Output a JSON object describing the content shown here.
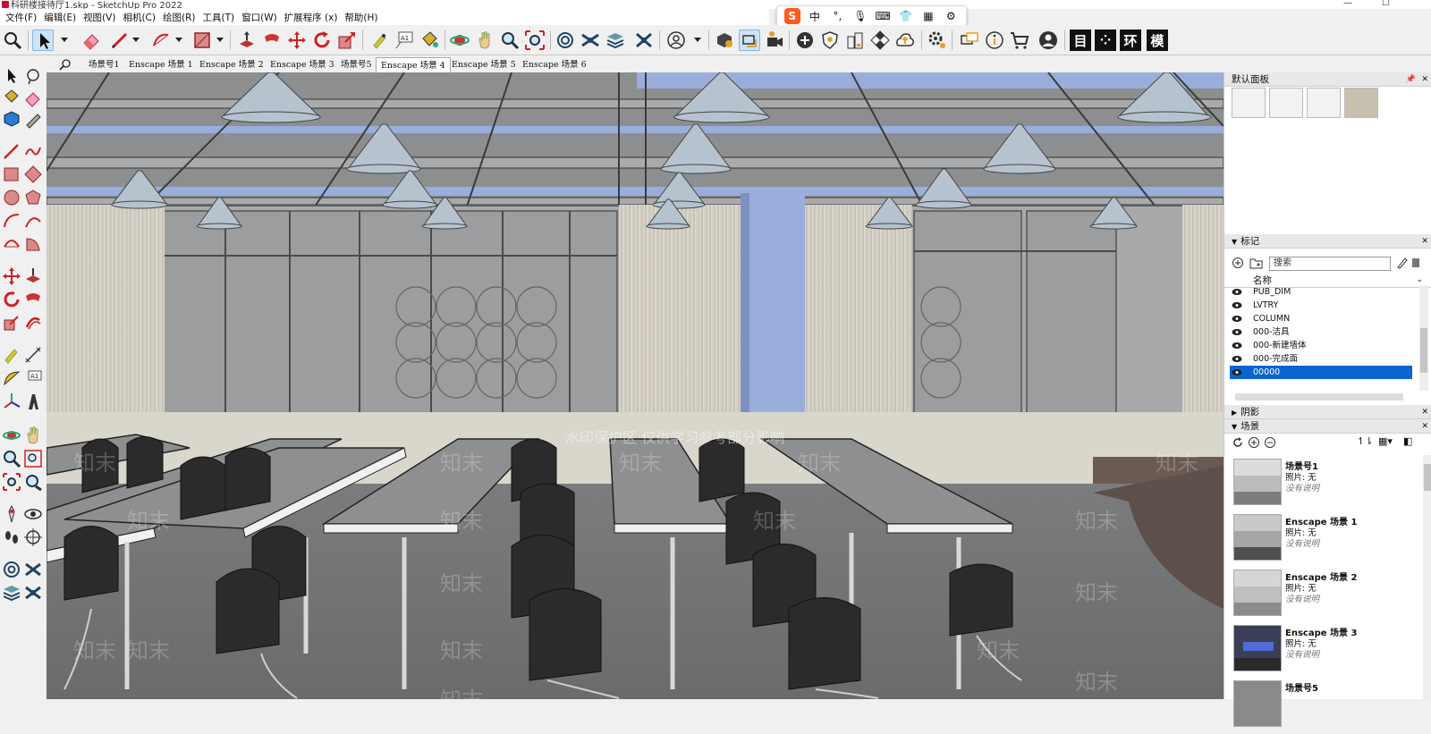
{
  "window": {
    "title": "科研楼接待厅1.skp - SketchUp Pro 2022",
    "controls": {
      "minimize": "—",
      "maximize": "☐"
    }
  },
  "menu": [
    "文件(F)",
    "编辑(E)",
    "视图(V)",
    "相机(C)",
    "绘图(R)",
    "工具(T)",
    "窗口(W)",
    "扩展程序 (x)",
    "帮助(H)"
  ],
  "ime": {
    "logo": "S",
    "lang": "中",
    "punct": "°,",
    "mic": "🎙",
    "keyboard": "⌨",
    "skin": "👕",
    "grid": "▦",
    "tools": "⚙"
  },
  "toolbar": {
    "text_buttons": [
      "目",
      "⁘",
      "环",
      "模"
    ]
  },
  "scene_tabs": [
    {
      "label": "场景号1",
      "active": false
    },
    {
      "label": "Enscape 场景 1",
      "active": false
    },
    {
      "label": "Enscape 场景 2",
      "active": false
    },
    {
      "label": "Enscape 场景 3",
      "active": false
    },
    {
      "label": "场景号5",
      "active": false
    },
    {
      "label": "Enscape 场景 4",
      "active": true
    },
    {
      "label": "Enscape 场景 5",
      "active": false
    },
    {
      "label": "Enscape 场景 6",
      "active": false
    }
  ],
  "viewport": {
    "watermark_banner": "水印保护区 仅供学习参考部分影响",
    "watermark": "知末"
  },
  "tray": {
    "default_panel": {
      "title": "默认面板",
      "close": "✕",
      "pin": "📌"
    },
    "tags": {
      "title": "标记",
      "search_placeholder": "搜索",
      "column_name": "名称",
      "rows": [
        {
          "name": "PUB_DIM",
          "selected": false
        },
        {
          "name": "LVTRY",
          "selected": false
        },
        {
          "name": "COLUMN",
          "selected": false
        },
        {
          "name": "000-洁具",
          "selected": false
        },
        {
          "name": "000-新建墙体",
          "selected": false
        },
        {
          "name": "000-完成面",
          "selected": false
        },
        {
          "name": "00000",
          "selected": true
        }
      ]
    },
    "shadows": {
      "title": "阴影"
    },
    "scenes": {
      "title": "场景",
      "items": [
        {
          "name": "场景号1",
          "photo": "照片: 无",
          "desc": "没有说明"
        },
        {
          "name": "Enscape 场景 1",
          "photo": "照片: 无",
          "desc": "没有说明"
        },
        {
          "name": "Enscape 场景 2",
          "photo": "照片: 无",
          "desc": "没有说明"
        },
        {
          "name": "Enscape 场景 3",
          "photo": "照片: 无",
          "desc": "没有说明"
        },
        {
          "name": "场景号5",
          "photo": "",
          "desc": ""
        }
      ]
    }
  },
  "colors": {
    "accent": "#0a64d2",
    "select_bg": "#cce4f7",
    "sky": "#9aaedb"
  }
}
